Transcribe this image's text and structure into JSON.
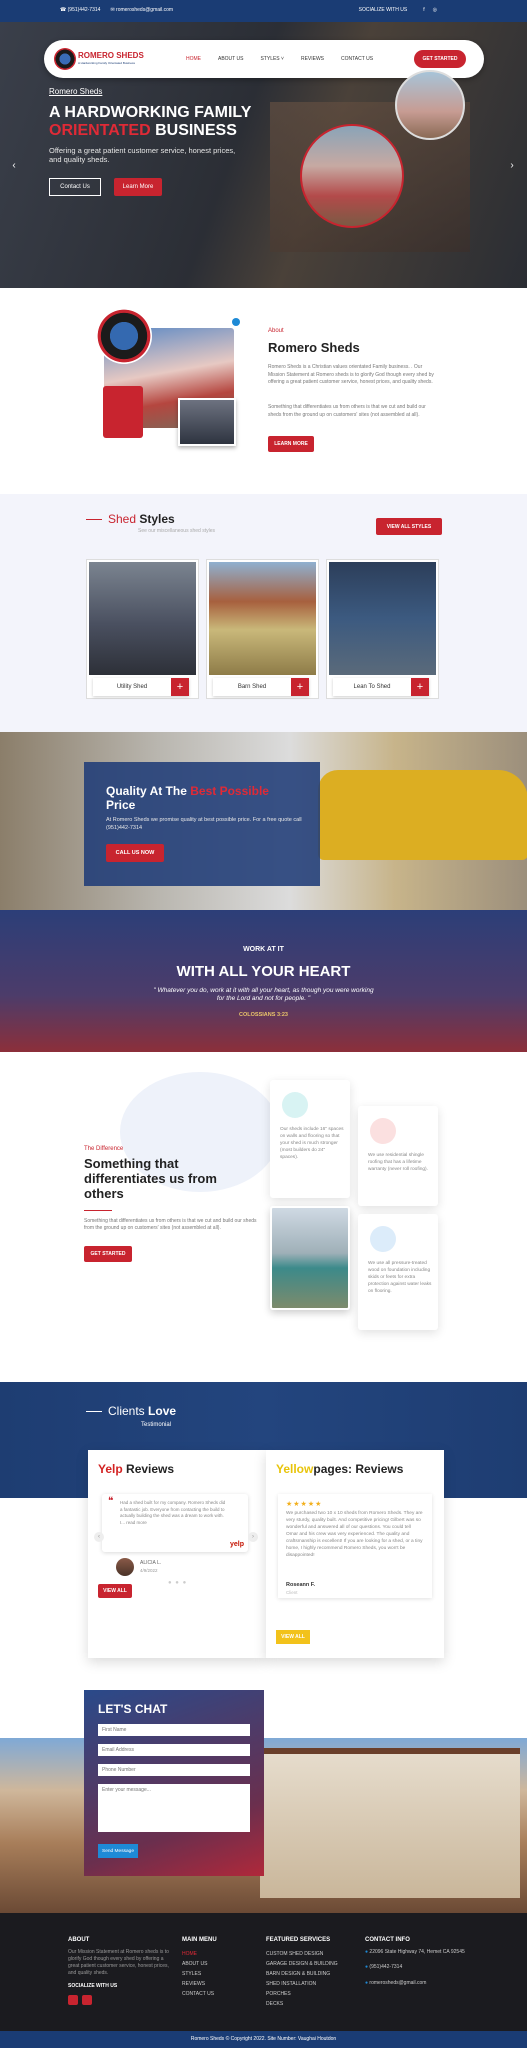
{
  "topbar": {
    "phone": "(951)442-7314",
    "email": "romerosheds@gmail.com",
    "social_label": "SOCIALIZE WITH US",
    "fb": "f",
    "ig": "◎"
  },
  "nav": {
    "logo_text": "ROMERO SHEDS",
    "logo_sub": "A Hardworking Family Orientated Business",
    "items": [
      "HOME",
      "ABOUT US",
      "STYLES ˅",
      "REVIEWS",
      "CONTACT US"
    ],
    "cta": "GET STARTED"
  },
  "hero": {
    "kicker": "Romero Sheds",
    "title_line1": "A HARDWORKING FAMILY",
    "title_red": "ORIENTATED",
    "title_line2": "BUSINESS",
    "text": "Offering a great patient customer service, honest prices, and quality sheds.",
    "btn_contact": "Contact Us",
    "btn_more": "Learn More",
    "prev": "‹",
    "next": "›"
  },
  "about": {
    "label": "About",
    "title": "Romero Sheds",
    "p1": "Romero Sheds is a Christian values orientated Family business. . Our Mission Statement at Romero sheds is to glorify God though every shed by offering a great patient customer service, honest prices, and quality sheds.",
    "p2": "Something that differentiates us from others is that we cut and build our sheds from the ground up on customers' sites (not assembled at all).",
    "btn": "LEARN MORE"
  },
  "styles": {
    "title_thin": "Shed",
    "title_bold": "Styles",
    "sub": "See our miscellaneous shed styles",
    "viewall": "VIEW ALL STYLES",
    "cards": [
      {
        "name": "Utility Shed"
      },
      {
        "name": "Barn Shed"
      },
      {
        "name": "Lean To Shed"
      }
    ],
    "plus": "+"
  },
  "quality": {
    "title_a": "Quality At The",
    "title_red": "Best Possible",
    "title_b": "Price",
    "text": "At Romero Sheds we promise quality at best possible price. For a free quote call (951)442-7314",
    "btn": "CALL US NOW"
  },
  "work": {
    "kicker": "WORK AT IT",
    "title": "WITH ALL YOUR HEART",
    "quote": "\" Whatever you do, work at it with all your heart, as though you were working for the Lord and not for people. \"",
    "ref": "COLOSSIANS 3:23"
  },
  "diff": {
    "label": "The Difference",
    "title": "Something that differentiates us from others",
    "text": "Something that differentiates us from others is that we cut and build our sheds from the ground up on customers' sites (not assembled at all).",
    "btn": "GET STARTED",
    "f1": "Our sheds include 16\" spaces on walls and flooring so that your shed is much stronger (most builders do 24\" spaces).",
    "f2": "We use residential shingle roofing that has a lifetime warranty (never roll roofing).",
    "f3": "We use all pressure-treated wood on foundation including skids or feets for extra protection against water leaks on flooring."
  },
  "clients": {
    "title_thin": "Clients",
    "title_bold": "Love",
    "sub": "Testimonial"
  },
  "yelp": {
    "title_red": "Yelp",
    "title_rest": "Reviews",
    "text": "Had a shed built for my company. Romero Sheds did a fantastic job. Everyone from contacting the build to actually building the shed was a dream to work with. I... read more",
    "logo": "yelp",
    "name": "ALICIA L.",
    "date": "4/9/2022",
    "btn": "VIEW ALL",
    "dots": "● ● ●"
  },
  "yp": {
    "title_yellow": "Yellow",
    "title_rest": "pages: Reviews",
    "stars": "★★★★★",
    "text": "We purchased two 10 x 10 sheds from Romero Sheds. They are very sturdy, quality built. And competitive pricing! Gilbert was so wonderful and answered all of our questions. You could tell Omar and his crew was very experienced. The quality and craftsmanship is excellent! If you are looking for a shed, or a tiny home, I highly recommend Romero Sheds, you won't be disappointed!",
    "name": "Roseann F.",
    "role": "Client",
    "btn": "VIEW ALL"
  },
  "chat": {
    "title": "LET'S CHAT",
    "first": "First Name",
    "email": "Email Address",
    "phone": "Phone Number",
    "msg": "Enter your message...",
    "send": "Send Message"
  },
  "footer": {
    "about_h": "ABOUT",
    "about_t": "Our Mission Statement at Romero sheds is to glorify God though every shed by offering a great patient customer service, honest prices, and quality sheds.",
    "social": "SOCIALIZE WITH US",
    "menu_h": "MAIN MENU",
    "menu": [
      "HOME",
      "ABOUT US",
      "STYLES",
      "REVIEWS",
      "CONTACT US"
    ],
    "serv_h": "FEATURED SERVICES",
    "serv": [
      "CUSTOM SHED DESIGN",
      "GARAGE DESIGN & BUILDING",
      "BARN DESIGN & BUILDING",
      "SHED INSTALLATION",
      "PORCHES",
      "DECKS"
    ],
    "contact_h": "CONTACT INFO",
    "address": "22096 State Highway 74, Hemet CA 92545",
    "phone": "(951)442-7314",
    "email": "romerosheds@gmail.com"
  },
  "copyright": "Romero Sheds © Copyright 2022. Site Number: Vaughai Houtdon"
}
